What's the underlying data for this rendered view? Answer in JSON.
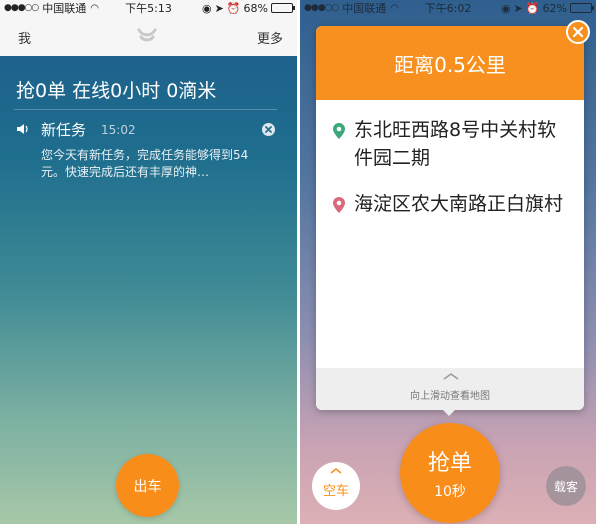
{
  "left": {
    "status": {
      "carrier": "中国联通",
      "time": "下午5:13",
      "battery": "68%",
      "battery_fraction": 0.68
    },
    "nav": {
      "me": "我",
      "more": "更多",
      "logo_icon": "didi-logo-icon"
    },
    "stats": "抢0单  在线0小时  0滴米",
    "task": {
      "title": "新任务",
      "time": "15:02",
      "body": "您今天有新任务，完成任务能够得到54元。快速完成后还有丰厚的神…"
    },
    "go_button": "出车"
  },
  "right": {
    "status": {
      "carrier": "中国联通",
      "time": "下午6:02",
      "battery": "62%",
      "battery_fraction": 0.62
    },
    "card": {
      "distance": "距离0.5公里",
      "from": "东北旺西路8号中关村软件园二期",
      "to": "海淀区农大南路正白旗村",
      "swipe_hint": "向上滑动查看地图"
    },
    "grab": {
      "label": "抢单",
      "timer": "10秒"
    },
    "empty_car": "空车",
    "passenger": "载客"
  },
  "colors": {
    "accent_orange": "#f7901e",
    "pin_green": "#3aa87a",
    "pin_pink": "#d86a7c"
  }
}
